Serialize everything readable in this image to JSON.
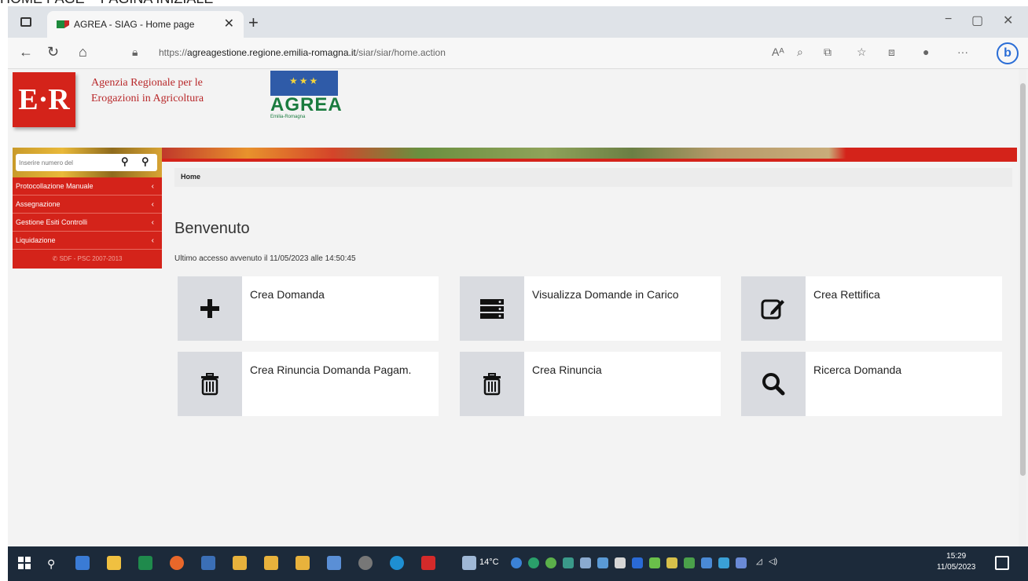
{
  "caption": "HOME PAGE – PAGINA INIZIALE",
  "browser": {
    "tab_title": "AGREA - SIAG - Home page",
    "tab_close": "✕",
    "new_tab": "+",
    "url_prefix": "https://",
    "url_domain": "agreagestione.regione.emilia-romagna.it",
    "url_path": "/siar/siar/home.action",
    "minimize": "−",
    "maximize": "▢",
    "close": "✕"
  },
  "header": {
    "er_logo": "E·R",
    "agency_line1": "Agenzia Regionale per le",
    "agency_line2": "Erogazioni in Agricoltura",
    "agrea_word": "AGREA",
    "agrea_sub": "Emilia-Romagna"
  },
  "sidebar": {
    "search_placeholder": "Inserire numero del",
    "items": [
      {
        "label": "Protocollazione Manuale",
        "chev": "‹"
      },
      {
        "label": "Assegnazione",
        "chev": "‹"
      },
      {
        "label": "Gestione Esiti Controlli",
        "chev": "‹"
      },
      {
        "label": "Liquidazione",
        "chev": "‹"
      }
    ],
    "footer": "✆ SDF - PSC 2007-2013"
  },
  "breadcrumb": "Home",
  "welcome": "Benvenuto",
  "last_access": "Ultimo accesso avvenuto il 11/05/2023 alle 14:50:45",
  "cards": [
    {
      "label": "Crea Domanda",
      "icon": "plus-icon"
    },
    {
      "label": "Visualizza Domande in Carico",
      "icon": "server-icon"
    },
    {
      "label": "Crea Rettifica",
      "icon": "edit-icon"
    },
    {
      "label": "Crea Rinuncia Domanda Pagam.",
      "icon": "trash-icon"
    },
    {
      "label": "Crea Rinuncia",
      "icon": "trash-icon"
    },
    {
      "label": "Ricerca Domanda",
      "icon": "search-icon"
    }
  ],
  "taskbar": {
    "weather": "14°C",
    "time": "15:29",
    "date": "11/05/2023"
  }
}
